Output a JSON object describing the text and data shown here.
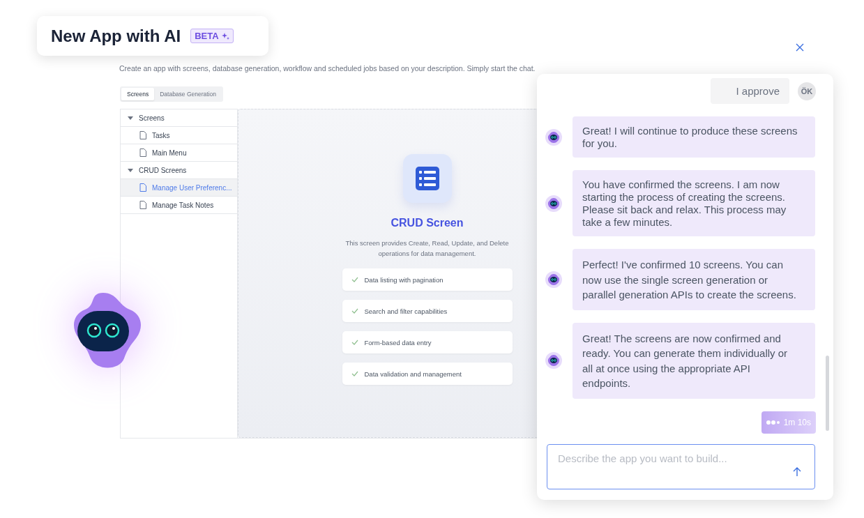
{
  "header": {
    "title": "New App with AI",
    "badge": "BETA"
  },
  "description": "Create an app with screens, database generation, workflow and scheduled jobs based on your description. Simply start the chat.",
  "tabs": [
    {
      "label": "Screens",
      "selected": true
    },
    {
      "label": "Database Generation",
      "selected": false
    }
  ],
  "tree": [
    {
      "label": "Screens",
      "expanded": true,
      "selected": false,
      "children": [
        {
          "label": "Tasks",
          "selected": false
        },
        {
          "label": "Main Menu",
          "selected": false
        }
      ]
    },
    {
      "label": "CRUD Screens",
      "expanded": true,
      "selected": false,
      "children": [
        {
          "label": "Manage User Preferenc...",
          "selected": true
        },
        {
          "label": "Manage Task Notes",
          "selected": false
        }
      ]
    }
  ],
  "preview": {
    "title": "CRUD Screen",
    "description": "This screen provides Create, Read, Update, and Delete operations for data management.",
    "features": [
      "Data listing with pagination",
      "Search and filter capabilities",
      "Form-based data entry",
      "Data validation and management"
    ]
  },
  "chat": {
    "messages": [
      {
        "kind": "user",
        "text": "I approve",
        "avatar": "ÖK"
      },
      {
        "kind": "bot",
        "text": "Great! I will continue to produce these screens for you."
      },
      {
        "kind": "bot",
        "text": "You have confirmed the screens. I am now starting the process of creating the screens. Please sit back and relax. This process may take a few minutes."
      },
      {
        "kind": "bot",
        "text": "Perfect! I've confirmed 10 screens. You can now use the single screen generation or parallel generation APIs to create the screens."
      },
      {
        "kind": "bot",
        "text": "Great! The screens are now confirmed and ready. You can generate them individually or all at once using the appropriate API endpoints."
      }
    ],
    "progress": "1m 10s",
    "input": {
      "placeholder": "Describe the app you want to build..."
    }
  }
}
